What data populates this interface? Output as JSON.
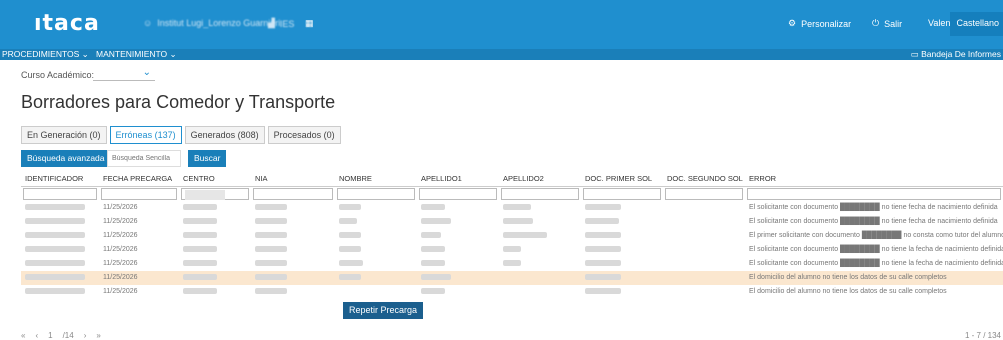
{
  "app": {
    "logo": "ıtaca",
    "user_label": "Institut Lugi_Lorenzo Guarnieri",
    "center_label": "IES",
    "personalizar": "Personalizar",
    "salir": "Salir",
    "lang_valencia": "Valencià",
    "lang_castellano": "Castellano"
  },
  "nav": {
    "procedimientos": "PROCEDIMIENTOS",
    "mantenimiento": "MANTENIMIENTO",
    "bandeja": "Bandeja De Informes"
  },
  "filters": {
    "curso_label": "Curso Académico:",
    "curso_value": ""
  },
  "page": {
    "title": "Borradores para Comedor y Transporte"
  },
  "tabs": [
    {
      "label": "En Generación (0)"
    },
    {
      "label": "Erróneas (137)"
    },
    {
      "label": "Generados (808)"
    },
    {
      "label": "Procesados (0)"
    }
  ],
  "search": {
    "advanced_label": "Búsqueda avanzada",
    "placeholder": "Búsqueda Sencilla",
    "buscar_label": "Buscar"
  },
  "table": {
    "columns": [
      "IDENTIFICADOR",
      "FECHA PRECARGA",
      "CENTRO",
      "NIA",
      "NOMBRE",
      "APELLIDO1",
      "APELLIDO2",
      "DOC. PRIMER SOL",
      "DOC. SEGUNDO SOL",
      "ERROR"
    ],
    "rows": [
      {
        "fecha": "11/25/2026",
        "error": "El solicitante con documento ████████ no tiene fecha de nacimiento definida"
      },
      {
        "fecha": "11/25/2026",
        "error": "El solicitante con documento ████████ no tiene fecha de nacimiento definida"
      },
      {
        "fecha": "11/25/2026",
        "error": "El primer solicitante con documento ████████ no consta como tutor del alumno"
      },
      {
        "fecha": "11/25/2026",
        "error": "El solicitante con documento ████████ no tiene la fecha de nacimiento definida"
      },
      {
        "fecha": "11/25/2026",
        "error": "El solicitante con documento ████████ no tiene la fecha de nacimiento definida"
      },
      {
        "fecha": "11/25/2026",
        "error": "El domicilio del alumno no tiene los datos de su calle completos"
      },
      {
        "fecha": "11/25/2026",
        "error": "El domicilio del alumno no tiene los datos de su calle completos"
      }
    ]
  },
  "context_menu": {
    "repetir": "Repetir Precarga"
  },
  "pager": {
    "first": "«",
    "prev": "‹",
    "page": "1",
    "of": "/14",
    "next": "›",
    "last": "»",
    "count": "1 - 7 / 134"
  },
  "colors": {
    "topbar": "#1f8fcf",
    "navbar": "#1a7fb9",
    "highlight": "#fbe7cf"
  }
}
